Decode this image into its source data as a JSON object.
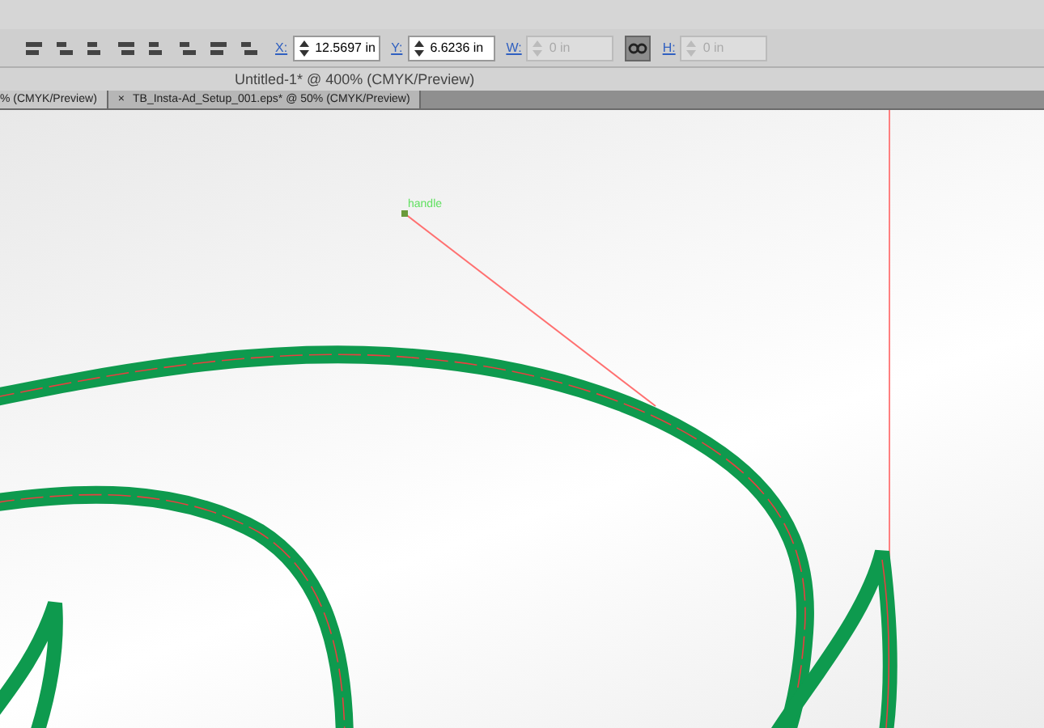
{
  "control_bar": {
    "fields": [
      {
        "label": "X:",
        "value": "12.5697 in",
        "disabled": false
      },
      {
        "label": "Y:",
        "value": "6.6236 in",
        "disabled": false
      },
      {
        "label": "W:",
        "value": "0 in",
        "disabled": true
      },
      {
        "label": "H:",
        "value": "0 in",
        "disabled": true
      }
    ],
    "link_on": true
  },
  "document_title": "Untitled-1* @ 400% (CMYK/Preview)",
  "tabs": [
    {
      "label": "% (CMYK/Preview)",
      "selected": true
    },
    {
      "label": "TB_Insta-Ad_Setup_001.eps* @ 50% (CMYK/Preview)",
      "selected": false,
      "close": "×"
    }
  ],
  "canvas": {
    "handle_label": "handle"
  }
}
